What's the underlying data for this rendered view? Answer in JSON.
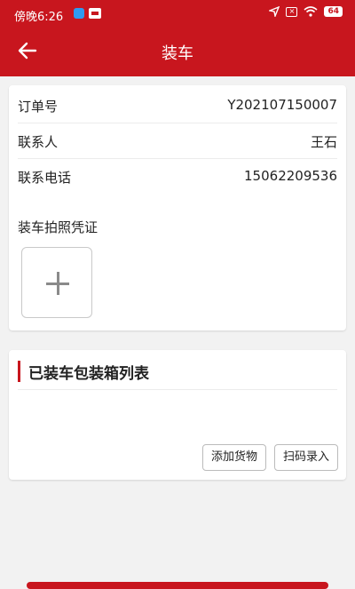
{
  "status_bar": {
    "time": "傍晚6:26",
    "battery": "64"
  },
  "app_bar": {
    "title": "装车"
  },
  "order_info": {
    "rows": [
      {
        "label": "订单号",
        "value": "Y202107150007"
      },
      {
        "label": "联系人",
        "value": "王石"
      },
      {
        "label": "联系电话",
        "value": "15062209536"
      }
    ],
    "photo_proof_label": "装车拍照凭证"
  },
  "packing_list": {
    "title": "已装车包装箱列表",
    "add_goods_label": "添加货物",
    "scan_entry_label": "扫码录入"
  },
  "colors": {
    "brand_red": "#c8161e",
    "background": "#f2f2f2"
  }
}
